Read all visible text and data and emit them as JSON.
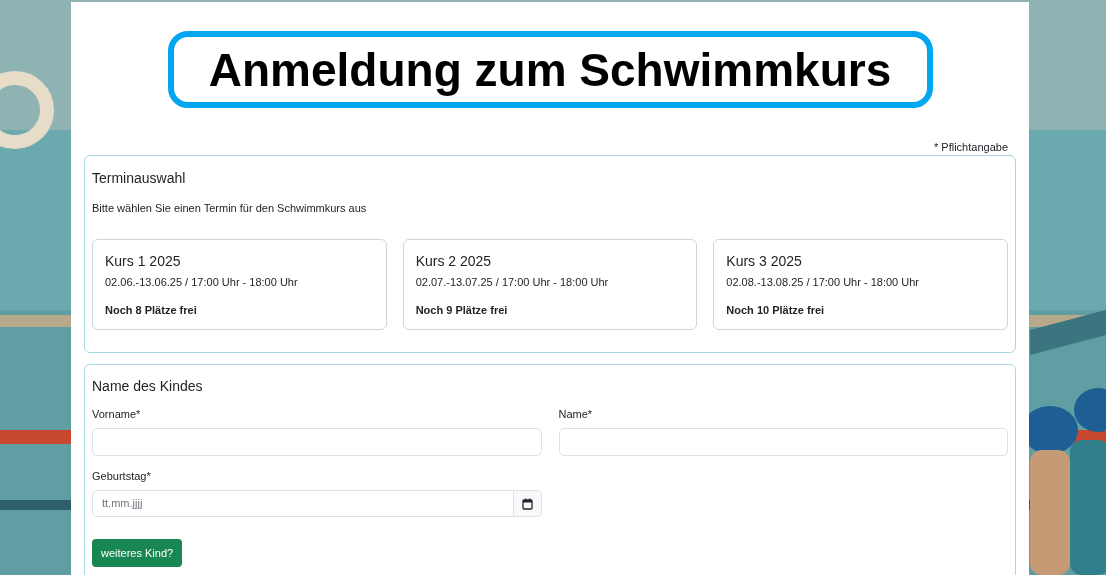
{
  "title": "Anmeldung zum Schwimmkurs",
  "required_note": "* Pflichtangabe",
  "date_section": {
    "heading": "Terminauswahl",
    "instruction": "Bitte wählen Sie einen Termin für den Schwimmkurs aus",
    "courses": [
      {
        "name": "Kurs 1 2025",
        "dates": "02.06.-13.06.25 / 17:00 Uhr - 18:00 Uhr",
        "availability": "Noch 8 Plätze frei"
      },
      {
        "name": "Kurs 2 2025",
        "dates": "02.07.-13.07.25 / 17:00 Uhr - 18:00 Uhr",
        "availability": "Noch 9 Plätze frei"
      },
      {
        "name": "Kurs 3 2025",
        "dates": "02.08.-13.08.25 / 17:00 Uhr - 18:00 Uhr",
        "availability": "Noch 10 Plätze frei"
      }
    ]
  },
  "child_section": {
    "heading": "Name des Kindes",
    "fields": [
      {
        "label": "Vorname*",
        "kind": "text"
      },
      {
        "label": "Name*",
        "kind": "text"
      },
      {
        "label": "Geburtstag*",
        "kind": "date",
        "placeholder": "tt.mm.jjjj"
      }
    ],
    "add_button": "weiteres Kind?"
  }
}
